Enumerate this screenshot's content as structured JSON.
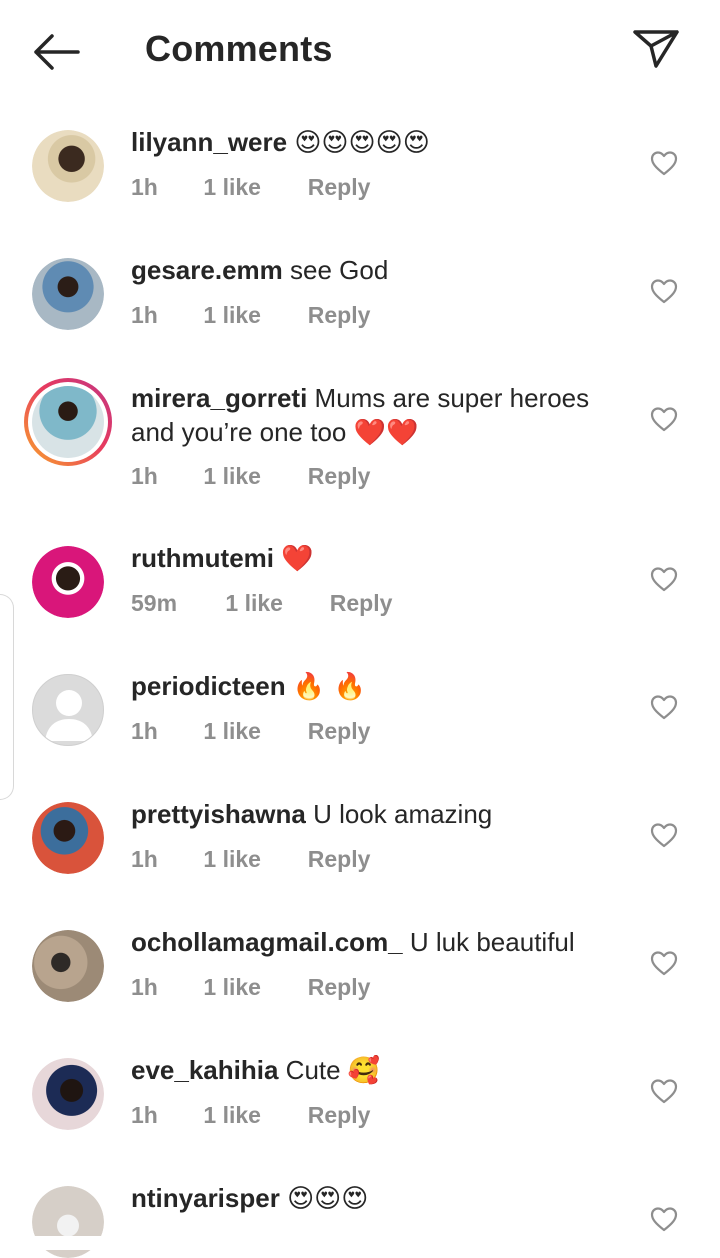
{
  "header": {
    "title": "Comments",
    "back_icon": "arrow-left-icon",
    "send_icon": "paper-plane-icon"
  },
  "reply_label": "Reply",
  "comments": [
    {
      "user": "lilyann_were",
      "text": "",
      "emoji": "😍😍😍😍😍",
      "time": "1h",
      "likes": "1 like"
    },
    {
      "user": "gesare.emm",
      "text": "see God",
      "emoji": "",
      "time": "1h",
      "likes": "1 like"
    },
    {
      "user": "mirera_gorreti",
      "text": "Mums are super heroes and you’re one too",
      "emoji": "❤️❤️",
      "time": "1h",
      "likes": "1 like",
      "story_ring": true
    },
    {
      "user": "ruthmutemi",
      "text": "",
      "emoji": "❤️",
      "time": "59m",
      "likes": "1 like"
    },
    {
      "user": "periodicteen",
      "text": "",
      "emoji": "🔥 🔥",
      "time": "1h",
      "likes": "1 like"
    },
    {
      "user": "prettyishawna",
      "text": "U look amazing",
      "emoji": "",
      "time": "1h",
      "likes": "1 like"
    },
    {
      "user": "ochollamagmail.com_",
      "text": "U luk beautiful",
      "emoji": "",
      "time": "1h",
      "likes": "1 like"
    },
    {
      "user": "eve_kahihia",
      "text": "Cute",
      "emoji": "🥰",
      "time": "1h",
      "likes": "1 like"
    },
    {
      "user": "ntinyarisper",
      "text": "",
      "emoji": "😍😍😍",
      "time": "",
      "likes": ""
    }
  ],
  "colors": {
    "text": "#262626",
    "meta": "#8e8e8e",
    "heart_outline": "#8e8e8e",
    "story_ring_start": "#f9a62b",
    "story_ring_end": "#c13584"
  }
}
